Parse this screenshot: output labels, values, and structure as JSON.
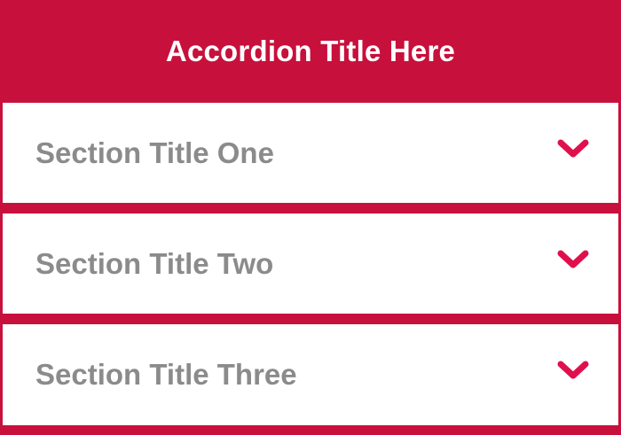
{
  "accordion": {
    "title": "Accordion Title Here",
    "accent_color": "#c8103c",
    "chevron_color": "#e0104d",
    "label_color": "#8b8b8b",
    "sections": [
      {
        "label": "Section Title One",
        "icon": "chevron-down-icon",
        "expanded": false
      },
      {
        "label": "Section Title Two",
        "icon": "chevron-down-icon",
        "expanded": false
      },
      {
        "label": "Section Title Three",
        "icon": "chevron-down-icon",
        "expanded": false
      }
    ]
  }
}
